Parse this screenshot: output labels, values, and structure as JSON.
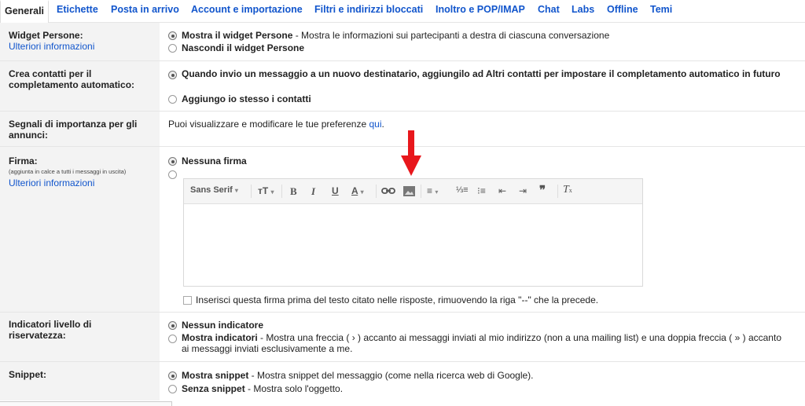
{
  "tabs": [
    {
      "label": "Generali",
      "active": true
    },
    {
      "label": "Etichette"
    },
    {
      "label": "Posta in arrivo"
    },
    {
      "label": "Account e importazione"
    },
    {
      "label": "Filtri e indirizzi bloccati"
    },
    {
      "label": "Inoltro e POP/IMAP"
    },
    {
      "label": "Chat"
    },
    {
      "label": "Labs"
    },
    {
      "label": "Offline"
    },
    {
      "label": "Temi"
    }
  ],
  "widget": {
    "label": "Widget Persone:",
    "link": "Ulteriori informazioni",
    "opt1_bold": "Mostra il widget Persone",
    "opt1_rest": " - Mostra le informazioni sui partecipanti a destra di ciascuna conversazione",
    "opt2_bold": "Nascondi il widget Persone"
  },
  "contacts": {
    "label": "Crea contatti per il completamento automatico:",
    "opt1": "Quando invio un messaggio a un nuovo destinatario, aggiungilo ad Altri contatti per impostare il completamento automatico in futuro",
    "opt2": "Aggiungo io stesso i contatti"
  },
  "ads": {
    "label": "Segnali di importanza per gli annunci:",
    "text": "Puoi visualizzare e modificare le tue preferenze ",
    "link": "qui",
    "after": "."
  },
  "signature": {
    "label": "Firma:",
    "note": "(aggiunta in calce a tutti i messaggi in uscita)",
    "link": "Ulteriori informazioni",
    "opt1": "Nessuna firma",
    "font": "Sans Serif",
    "checkbox_label": "Inserisci questa firma prima del testo citato nelle risposte, rimuovendo la riga \"--\" che la precede."
  },
  "privacy": {
    "label": "Indicatori livello di riservatezza:",
    "opt1": "Nessun indicatore",
    "opt2_bold": "Mostra indicatori",
    "opt2_rest": " - Mostra una freccia ( › ) accanto ai messaggi inviati al mio indirizzo (non a una mailing list) e una doppia freccia ( » ) accanto ai messaggi inviati esclusivamente a me."
  },
  "snippet": {
    "label": "Snippet:",
    "opt1_bold": "Mostra snippet",
    "opt1_rest": " - Mostra snippet del messaggio (come nella ricerca web di Google).",
    "opt2_bold": "Senza snippet",
    "opt2_rest": " - Mostra solo l'oggetto."
  },
  "colors": {
    "link": "#1155cc",
    "annotation_arrow": "#e8171c"
  }
}
